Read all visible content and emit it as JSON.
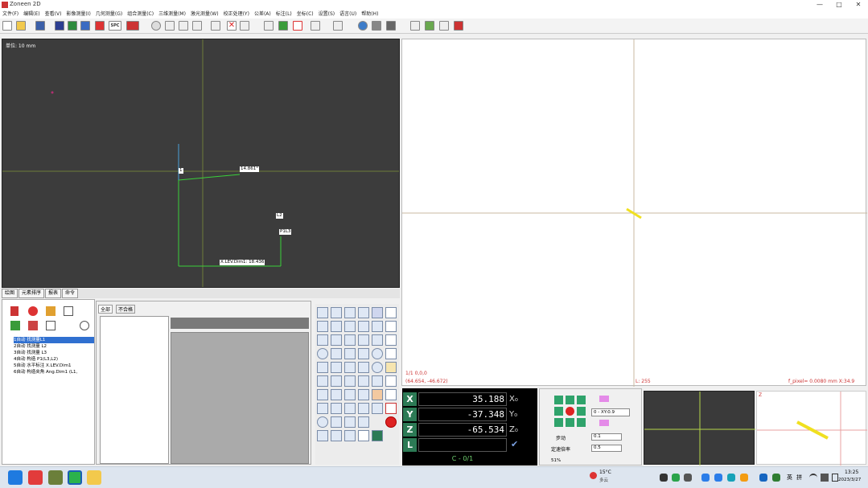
{
  "app": {
    "title": "Zoneen 2D"
  },
  "window_controls": {
    "minimize": "—",
    "maximize": "□",
    "close": "✕"
  },
  "menu": [
    "文件(F)",
    "编辑(E)",
    "查看(V)",
    "影像测量(I)",
    "几何测量(G)",
    "组合测量(C)",
    "三维测量(M)",
    "激光测量(W)",
    "校正处理(Y)",
    "公差(A)",
    "标注(L)",
    "坐标(C)",
    "设置(S)",
    "语言(U)",
    "帮助(H)"
  ],
  "toolbar": {
    "spc_label": "SPC"
  },
  "left_view": {
    "unit_label": "单位: 10 mm",
    "point_label": "1",
    "angle_label": "14.861°",
    "line_label": "L2",
    "p1_label": "P1L3",
    "dist_label": "X.LEV.Dim1: 18.436"
  },
  "right_view": {
    "coord_top": "1/1  0,0,0",
    "coord_pos": "(64.654, -46.672)",
    "l_value": "L: 255",
    "pixel_info": "f_pixel= 0.0080 mm   X:34.9"
  },
  "bottom_tabs": [
    "绘图",
    "元素排序",
    "报表",
    "命令"
  ],
  "tree_items": [
    "1自动 找测量L1",
    "2自动 找测量 L2",
    "3自动 找测量 L3",
    "4自动 构造 P1(L3,L2)",
    "5自动 水平标注 X.LEV.Dim1",
    "6自动 构造夹角 Ang.Dim1 (L1,"
  ],
  "mid_tabs": [
    "全部",
    "不合格"
  ],
  "dro": {
    "rows": [
      {
        "axis": "X",
        "value": "35.188",
        "sub": "X₀"
      },
      {
        "axis": "Y",
        "value": "-37.348",
        "sub": "Y₀"
      },
      {
        "axis": "Z",
        "value": "-65.534",
        "sub": "Z₀"
      },
      {
        "axis": "L",
        "value": "",
        "sub": ""
      }
    ],
    "bottom_text": "C - 0/1"
  },
  "jog": {
    "mode_select": "0 - XY:0.9",
    "step_label": "步动",
    "step_value": "0.1",
    "speed_label": "定速倍率",
    "speed_value": "0.5",
    "percent": "51%"
  },
  "cam2": {
    "z_label": "Z"
  },
  "taskbar": {
    "weather_temp": "15°C",
    "weather_desc": "多云",
    "lang": "英",
    "ime": "拼",
    "time": "13:25",
    "date": "2023/3/27"
  }
}
